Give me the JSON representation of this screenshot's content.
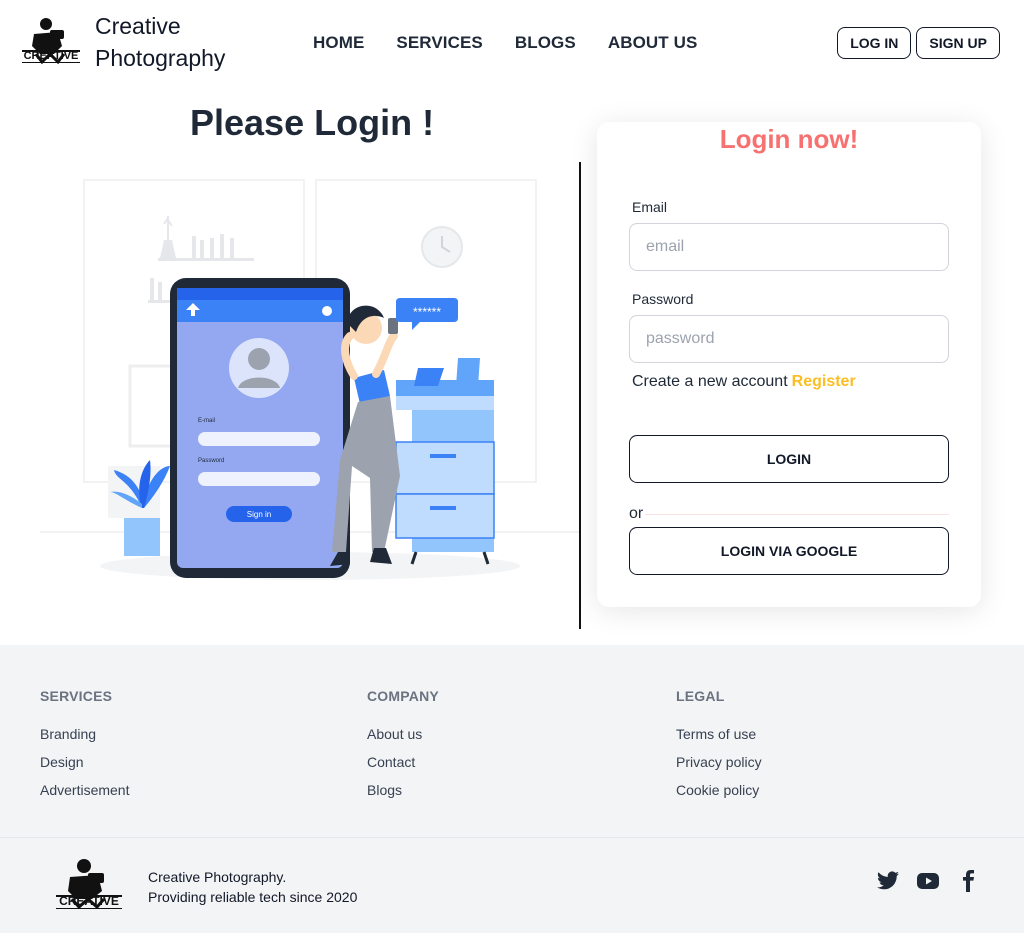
{
  "header": {
    "brand_line1": "Creative",
    "brand_line2": "Photography",
    "logo_icon": "camera-photographer-logo",
    "nav": [
      "HOME",
      "SERVICES",
      "BLOGS",
      "ABOUT US"
    ],
    "login_label": "LOG IN",
    "signup_label": "SIGN UP"
  },
  "main": {
    "title": "Please Login !",
    "illustration": {
      "icon": "login-illustration",
      "email_label": "E-mail",
      "password_label": "Password",
      "signin_label": "Sign in"
    }
  },
  "login_card": {
    "title": "Login now!",
    "email_label": "Email",
    "email_placeholder": "email",
    "password_label": "Password",
    "password_placeholder": "password",
    "create_text": "Create a new account",
    "register_link": "Register",
    "login_button": "LOGIN",
    "or_text": "or",
    "google_button": "LOGIN VIA GOOGLE"
  },
  "footer": {
    "columns": [
      {
        "title": "SERVICES",
        "links": [
          "Branding",
          "Design",
          "Advertisement"
        ]
      },
      {
        "title": "COMPANY",
        "links": [
          "About us",
          "Contact",
          "Blogs"
        ]
      },
      {
        "title": "LEGAL",
        "links": [
          "Terms of use",
          "Privacy policy",
          "Cookie policy"
        ]
      }
    ],
    "tagline_line1": "Creative Photography.",
    "tagline_line2": "Providing reliable tech since 2020",
    "social_icons": [
      "twitter-icon",
      "youtube-icon",
      "facebook-icon"
    ]
  },
  "colors": {
    "accent_red": "#f87171",
    "register_yellow": "#fbbf24",
    "illustration_blue": "#3b82f6",
    "footer_bg": "#f3f4f6"
  }
}
